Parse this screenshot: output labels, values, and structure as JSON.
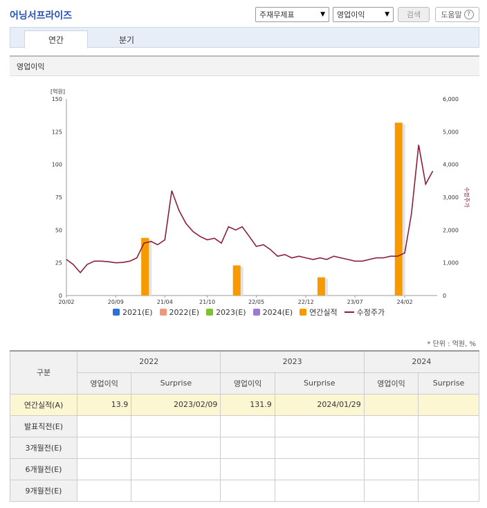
{
  "header": {
    "title": "어닝서프라이즈",
    "select1": "주재무제표",
    "select2": "영업이익",
    "search_label": "검색",
    "help_label": "도움말",
    "help_glyph": "?"
  },
  "tabs": [
    "연간",
    "분기"
  ],
  "section_title": "영업이익",
  "chart_data": {
    "type": "bar",
    "left_axis_unit": "[억원]",
    "left_ticks": [
      "0",
      "25",
      "50",
      "75",
      "100",
      "125",
      "150"
    ],
    "right_ticks": [
      "0",
      "1,000",
      "2,000",
      "3,000",
      "4,000",
      "5,000",
      "6,000"
    ],
    "right_axis_label": "수정주가",
    "x_ticks": [
      "20/02",
      "20/09",
      "21/04",
      "21/10",
      "22/05",
      "22/12",
      "23/07",
      "24/02"
    ],
    "ylim_left": [
      0,
      150
    ],
    "ylim_right": [
      0,
      6000
    ],
    "bars": [
      {
        "date": "2021-01",
        "value": 44
      },
      {
        "date": "2022-02",
        "value": 23
      },
      {
        "date": "2023-02",
        "value": 13.9
      },
      {
        "date": "2024-01",
        "value": 131.9
      }
    ],
    "price_series": [
      {
        "date": "2020-02",
        "value": 1100
      },
      {
        "date": "2020-03",
        "value": 950
      },
      {
        "date": "2020-04",
        "value": 700
      },
      {
        "date": "2020-05",
        "value": 950
      },
      {
        "date": "2020-06",
        "value": 1050
      },
      {
        "date": "2020-07",
        "value": 1050
      },
      {
        "date": "2020-08",
        "value": 1030
      },
      {
        "date": "2020-09",
        "value": 1000
      },
      {
        "date": "2020-10",
        "value": 1010
      },
      {
        "date": "2020-11",
        "value": 1050
      },
      {
        "date": "2020-12",
        "value": 1150
      },
      {
        "date": "2021-01",
        "value": 1600
      },
      {
        "date": "2021-02",
        "value": 1650
      },
      {
        "date": "2021-03",
        "value": 1550
      },
      {
        "date": "2021-04",
        "value": 1700
      },
      {
        "date": "2021-05",
        "value": 3200
      },
      {
        "date": "2021-06",
        "value": 2600
      },
      {
        "date": "2021-07",
        "value": 2200
      },
      {
        "date": "2021-08",
        "value": 1950
      },
      {
        "date": "2021-09",
        "value": 1800
      },
      {
        "date": "2021-10",
        "value": 1700
      },
      {
        "date": "2021-11",
        "value": 1750
      },
      {
        "date": "2021-12",
        "value": 1600
      },
      {
        "date": "2022-01",
        "value": 2100
      },
      {
        "date": "2022-02",
        "value": 2000
      },
      {
        "date": "2022-03",
        "value": 2100
      },
      {
        "date": "2022-04",
        "value": 1800
      },
      {
        "date": "2022-05",
        "value": 1500
      },
      {
        "date": "2022-06",
        "value": 1550
      },
      {
        "date": "2022-07",
        "value": 1400
      },
      {
        "date": "2022-08",
        "value": 1200
      },
      {
        "date": "2022-09",
        "value": 1250
      },
      {
        "date": "2022-10",
        "value": 1150
      },
      {
        "date": "2022-11",
        "value": 1200
      },
      {
        "date": "2022-12",
        "value": 1150
      },
      {
        "date": "2023-01",
        "value": 1100
      },
      {
        "date": "2023-02",
        "value": 1150
      },
      {
        "date": "2023-03",
        "value": 1100
      },
      {
        "date": "2023-04",
        "value": 1200
      },
      {
        "date": "2023-05",
        "value": 1150
      },
      {
        "date": "2023-06",
        "value": 1100
      },
      {
        "date": "2023-07",
        "value": 1050
      },
      {
        "date": "2023-08",
        "value": 1050
      },
      {
        "date": "2023-09",
        "value": 1100
      },
      {
        "date": "2023-10",
        "value": 1150
      },
      {
        "date": "2023-11",
        "value": 1150
      },
      {
        "date": "2023-12",
        "value": 1200
      },
      {
        "date": "2024-01",
        "value": 1200
      },
      {
        "date": "2024-02",
        "value": 1300
      },
      {
        "date": "2024-03",
        "value": 2500
      },
      {
        "date": "2024-04",
        "value": 4600
      },
      {
        "date": "2024-05",
        "value": 3400
      },
      {
        "date": "2024-06",
        "value": 3800
      }
    ]
  },
  "legend": [
    {
      "label": "2021(E)",
      "color": "#2f6fd8",
      "kind": "box"
    },
    {
      "label": "2022(E)",
      "color": "#ee9a7a",
      "kind": "box"
    },
    {
      "label": "2023(E)",
      "color": "#7dc32b",
      "kind": "box"
    },
    {
      "label": "2024(E)",
      "color": "#9b7ad6",
      "kind": "box"
    },
    {
      "label": "연간실적",
      "color": "#f79a00",
      "kind": "box"
    },
    {
      "label": "수정주가",
      "color": "#8b1d3a",
      "kind": "line"
    }
  ],
  "unit_note": "* 단위 : 억원, %",
  "table": {
    "corner": "구분",
    "years": [
      "2022",
      "2023",
      "2024"
    ],
    "subheaders": [
      "영업이익",
      "Surprise"
    ],
    "rows": [
      {
        "label": "연간실적(A)",
        "cells": [
          "13.9",
          "2023/02/09",
          "131.9",
          "2024/01/29",
          "",
          ""
        ]
      },
      {
        "label": "발표직전(E)",
        "cells": [
          "",
          "",
          "",
          "",
          "",
          ""
        ]
      },
      {
        "label": "3개월전(E)",
        "cells": [
          "",
          "",
          "",
          "",
          "",
          ""
        ]
      },
      {
        "label": "6개월전(E)",
        "cells": [
          "",
          "",
          "",
          "",
          "",
          ""
        ]
      },
      {
        "label": "9개월전(E)",
        "cells": [
          "",
          "",
          "",
          "",
          "",
          ""
        ]
      }
    ]
  },
  "colors": {
    "bar": "#f79a00",
    "price_line": "#8b1d3a",
    "highlight_row": "#fdf6d3"
  }
}
